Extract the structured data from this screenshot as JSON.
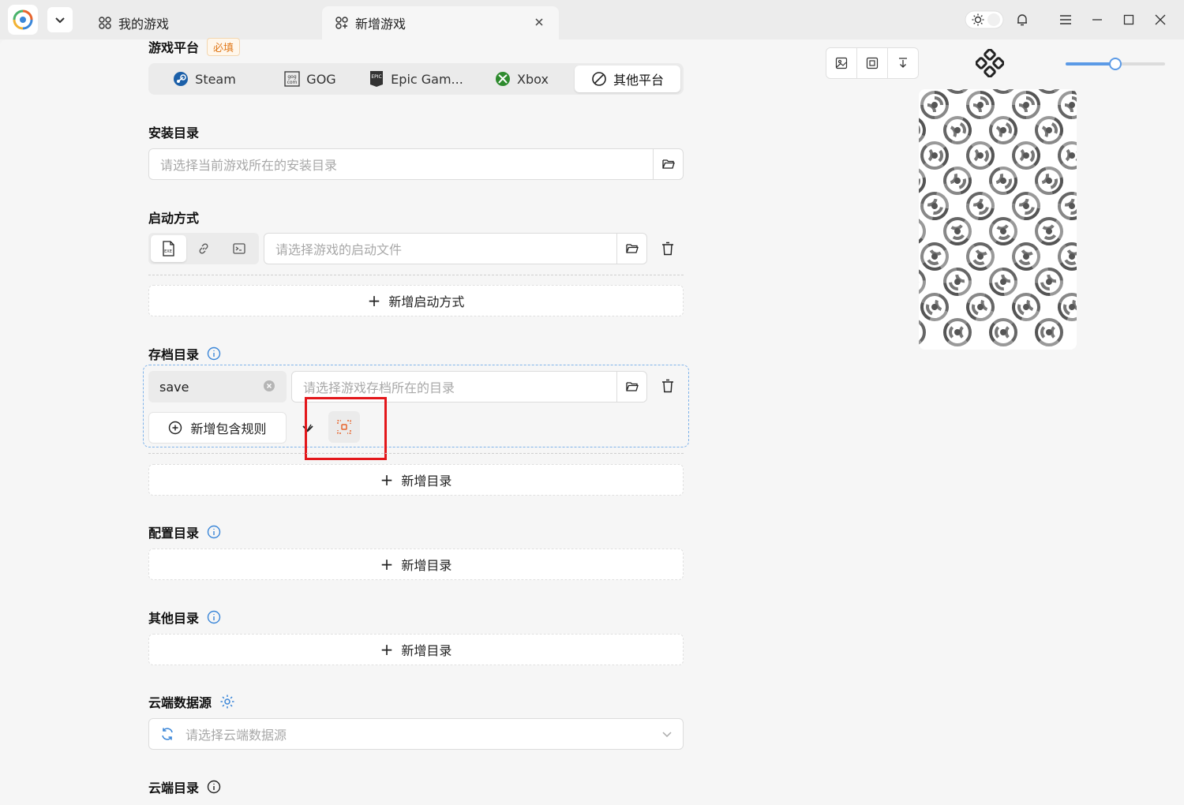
{
  "titlebar": {
    "tabs": [
      {
        "label": "我的游戏"
      },
      {
        "label": "新增游戏"
      }
    ]
  },
  "form": {
    "platform": {
      "label": "游戏平台",
      "required_badge": "必填",
      "options": [
        "Steam",
        "GOG",
        "Epic Gam...",
        "Xbox",
        "其他平台"
      ],
      "selected": "其他平台"
    },
    "install_dir": {
      "label": "安装目录",
      "placeholder": "请选择当前游戏所在的安装目录"
    },
    "launch": {
      "label": "启动方式",
      "placeholder": "请选择游戏的启动文件",
      "add_label": "新增启动方式"
    },
    "save_dir": {
      "label": "存档目录",
      "tag_value": "save",
      "placeholder": "请选择游戏存档所在的目录",
      "add_rule_label": "新增包含规则",
      "add_dir_label": "新增目录"
    },
    "config_dir": {
      "label": "配置目录",
      "add_dir_label": "新增目录"
    },
    "other_dir": {
      "label": "其他目录",
      "add_dir_label": "新增目录"
    },
    "cloud_source": {
      "label": "云端数据源",
      "placeholder": "请选择云端数据源"
    },
    "cloud_dir": {
      "label": "云端目录"
    }
  },
  "cover": {
    "zoom_level": 0.5
  },
  "colors": {
    "accent": "#5b9ae6",
    "required": "#e07a1c",
    "highlight": "#e3171b",
    "info_icon": "#3a86d8"
  }
}
